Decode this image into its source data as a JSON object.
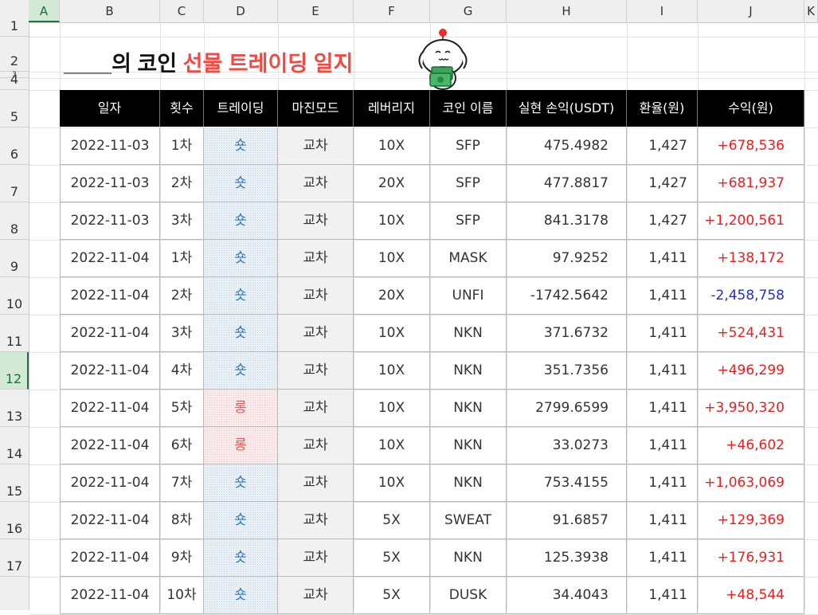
{
  "columns": [
    "A",
    "B",
    "C",
    "D",
    "E",
    "F",
    "G",
    "H",
    "I",
    "J",
    "K"
  ],
  "rows": [
    "1",
    "2",
    "3",
    "4",
    "5",
    "6",
    "7",
    "8",
    "9",
    "10",
    "11",
    "12",
    "13",
    "14",
    "15",
    "16",
    "17"
  ],
  "title": {
    "blank": "____",
    "prefix": "의 코인 ",
    "highlight": "선물 트레이딩 일지"
  },
  "headers": [
    "일자",
    "횟수",
    "트레이딩",
    "마진모드",
    "레버리지",
    "코인 이름",
    "실현 손익(USDT)",
    "환율(원)",
    "수익(원)"
  ],
  "entries": [
    {
      "date": "2022-11-03",
      "count": "1차",
      "trade": "숏",
      "margin": "교차",
      "leverage": "10X",
      "coin": "SFP",
      "pnl": "475.4982",
      "rate": "1,427",
      "profit": "+678,536"
    },
    {
      "date": "2022-11-03",
      "count": "2차",
      "trade": "숏",
      "margin": "교차",
      "leverage": "20X",
      "coin": "SFP",
      "pnl": "477.8817",
      "rate": "1,427",
      "profit": "+681,937"
    },
    {
      "date": "2022-11-03",
      "count": "3차",
      "trade": "숏",
      "margin": "교차",
      "leverage": "10X",
      "coin": "SFP",
      "pnl": "841.3178",
      "rate": "1,427",
      "profit": "+1,200,561"
    },
    {
      "date": "2022-11-04",
      "count": "1차",
      "trade": "숏",
      "margin": "교차",
      "leverage": "10X",
      "coin": "MASK",
      "pnl": "97.9252",
      "rate": "1,411",
      "profit": "+138,172"
    },
    {
      "date": "2022-11-04",
      "count": "2차",
      "trade": "숏",
      "margin": "교차",
      "leverage": "20X",
      "coin": "UNFI",
      "pnl": "-1742.5642",
      "rate": "1,411",
      "profit": "-2,458,758"
    },
    {
      "date": "2022-11-04",
      "count": "3차",
      "trade": "숏",
      "margin": "교차",
      "leverage": "10X",
      "coin": "NKN",
      "pnl": "371.6732",
      "rate": "1,411",
      "profit": "+524,431"
    },
    {
      "date": "2022-11-04",
      "count": "4차",
      "trade": "숏",
      "margin": "교차",
      "leverage": "10X",
      "coin": "NKN",
      "pnl": "351.7356",
      "rate": "1,411",
      "profit": "+496,299"
    },
    {
      "date": "2022-11-04",
      "count": "5차",
      "trade": "롱",
      "margin": "교차",
      "leverage": "10X",
      "coin": "NKN",
      "pnl": "2799.6599",
      "rate": "1,411",
      "profit": "+3,950,320"
    },
    {
      "date": "2022-11-04",
      "count": "6차",
      "trade": "롱",
      "margin": "교차",
      "leverage": "10X",
      "coin": "NKN",
      "pnl": "33.0273",
      "rate": "1,411",
      "profit": "+46,602"
    },
    {
      "date": "2022-11-04",
      "count": "7차",
      "trade": "숏",
      "margin": "교차",
      "leverage": "10X",
      "coin": "NKN",
      "pnl": "753.4155",
      "rate": "1,411",
      "profit": "+1,063,069"
    },
    {
      "date": "2022-11-04",
      "count": "8차",
      "trade": "숏",
      "margin": "교차",
      "leverage": "5X",
      "coin": "SWEAT",
      "pnl": "91.6857",
      "rate": "1,411",
      "profit": "+129,369"
    },
    {
      "date": "2022-11-04",
      "count": "9차",
      "trade": "숏",
      "margin": "교차",
      "leverage": "5X",
      "coin": "NKN",
      "pnl": "125.3938",
      "rate": "1,411",
      "profit": "+176,931"
    },
    {
      "date": "2022-11-04",
      "count": "10차",
      "trade": "숏",
      "margin": "교차",
      "leverage": "5X",
      "coin": "DUSK",
      "pnl": "34.4043",
      "rate": "1,411",
      "profit": "+48,544"
    }
  ],
  "selected_column": "A",
  "selected_row": "12",
  "colors": {
    "accent_red": "#f04a42",
    "positive": "#ee1c1c",
    "negative": "#2530c8",
    "excel_green": "#217346"
  }
}
